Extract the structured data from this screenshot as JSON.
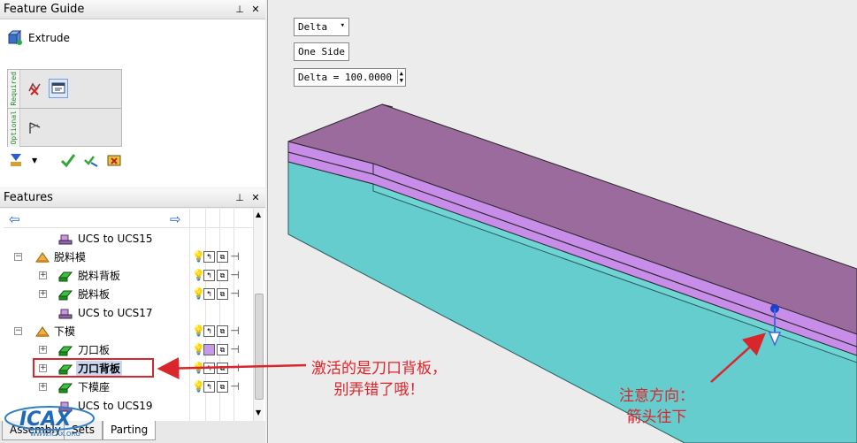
{
  "feature_guide": {
    "title": "Feature Guide",
    "pin_icon": "pin-icon",
    "close_icon": "close-icon",
    "feature_name": "Extrude",
    "tab_required": "Required",
    "tab_optional": "Optional"
  },
  "features_panel": {
    "title": "Features",
    "rows": [
      {
        "label": "UCS to UCS15",
        "kind": "ucs",
        "expander": ""
      },
      {
        "label": "脱料模",
        "kind": "group",
        "expander": "−"
      },
      {
        "label": "脱料背板",
        "kind": "solid",
        "expander": "+"
      },
      {
        "label": "脱料板",
        "kind": "solid",
        "expander": "+"
      },
      {
        "label": "UCS to UCS17",
        "kind": "ucs",
        "expander": ""
      },
      {
        "label": "下模",
        "kind": "group",
        "expander": "−"
      },
      {
        "label": "刀口板",
        "kind": "solid",
        "expander": "+"
      },
      {
        "label": "刀口背板",
        "kind": "solid",
        "expander": "+"
      },
      {
        "label": "下模座",
        "kind": "solid",
        "expander": "+"
      },
      {
        "label": "UCS to UCS19",
        "kind": "ucs",
        "expander": ""
      }
    ]
  },
  "bottom_tabs": [
    {
      "label": "Assembly"
    },
    {
      "label": "Sets"
    },
    {
      "label": "Parting"
    }
  ],
  "viewport": {
    "mode_dropdown": "Delta",
    "side_button": "One Side",
    "delta_label": "Delta = 100.0000",
    "dropdown_arrow": "▾"
  },
  "annotations": {
    "left_line1": "激活的是刀口背板，",
    "left_line2": "别弄错了哦！",
    "right_line1": "注意方向：",
    "right_line2": "箭头往下"
  },
  "watermark": {
    "text": "ICAX",
    "url_text": "WWW.ICAX.ORG"
  },
  "colors": {
    "annotation_red": "#e0222a",
    "top_plate": "#9b6b9e",
    "mid_plate": "#c78de8",
    "base_block": "#63cccc"
  }
}
